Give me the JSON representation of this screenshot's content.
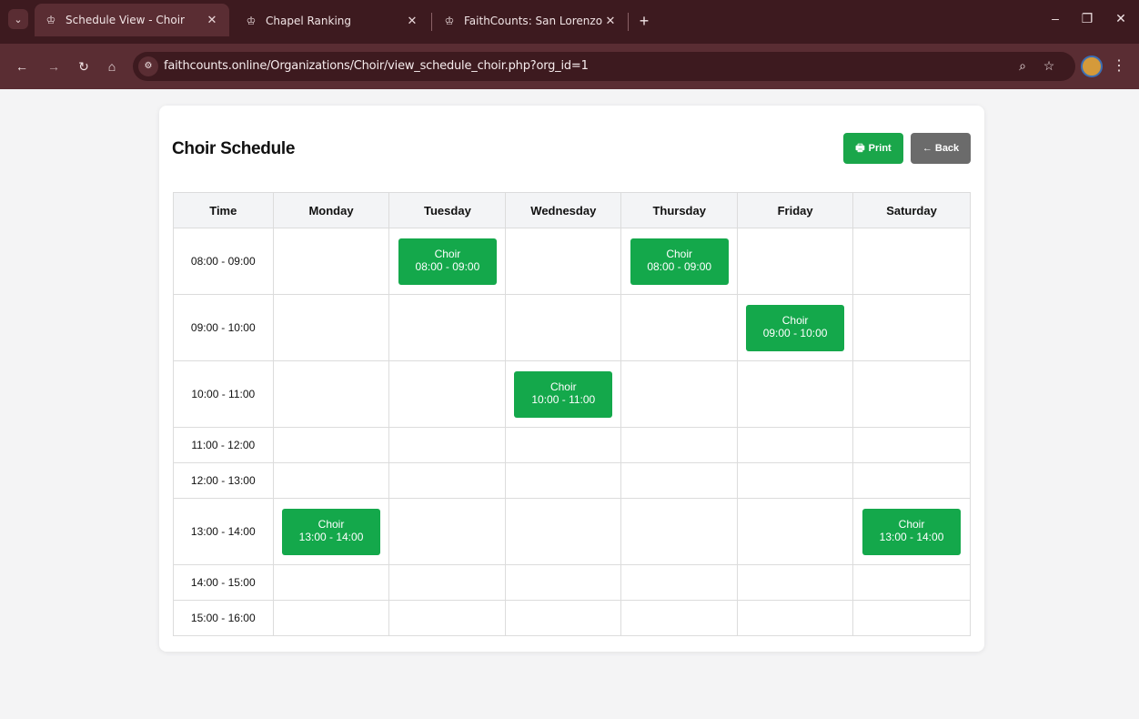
{
  "browser": {
    "tabs": [
      {
        "label": "Schedule View - Choir",
        "active": true
      },
      {
        "label": "Chapel Ranking",
        "active": false
      },
      {
        "label": "FaithCounts: San Lorenzo Diako",
        "active": false
      }
    ],
    "url": "faithcounts.online/Organizations/Choir/view_schedule_choir.php?org_id=1"
  },
  "page": {
    "title": "Choir Schedule",
    "print_label": "Print",
    "back_label": "← Back"
  },
  "schedule": {
    "headers": [
      "Time",
      "Monday",
      "Tuesday",
      "Wednesday",
      "Thursday",
      "Friday",
      "Saturday"
    ],
    "rows": [
      {
        "time": "08:00 - 09:00",
        "cells": [
          "",
          "Choir|08:00 - 09:00",
          "",
          "Choir|08:00 - 09:00",
          "",
          ""
        ]
      },
      {
        "time": "09:00 - 10:00",
        "cells": [
          "",
          "",
          "",
          "",
          "Choir|09:00 - 10:00",
          ""
        ]
      },
      {
        "time": "10:00 - 11:00",
        "cells": [
          "",
          "",
          "Choir|10:00 - 11:00",
          "",
          "",
          ""
        ]
      },
      {
        "time": "11:00 - 12:00",
        "cells": [
          "",
          "",
          "",
          "",
          "",
          ""
        ]
      },
      {
        "time": "12:00 - 13:00",
        "cells": [
          "",
          "",
          "",
          "",
          "",
          ""
        ]
      },
      {
        "time": "13:00 - 14:00",
        "cells": [
          "Choir|13:00 - 14:00",
          "",
          "",
          "",
          "",
          "Choir|13:00 - 14:00"
        ]
      },
      {
        "time": "14:00 - 15:00",
        "cells": [
          "",
          "",
          "",
          "",
          "",
          ""
        ]
      },
      {
        "time": "15:00 - 16:00",
        "cells": [
          "",
          "",
          "",
          "",
          "",
          ""
        ]
      }
    ]
  },
  "colors": {
    "event": "#14a84b",
    "print": "#1aa64a",
    "back": "#6b6b6b",
    "chrome": "#3d1a1f"
  }
}
